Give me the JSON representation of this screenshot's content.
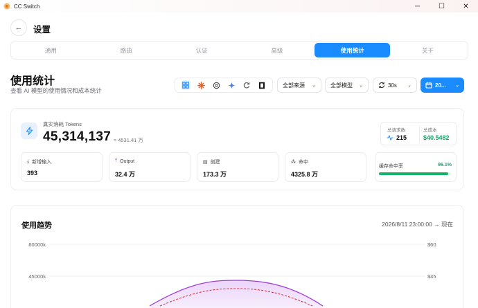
{
  "window": {
    "title": "CC Switch",
    "minimize": "─",
    "maximize": "☐",
    "close": "✕"
  },
  "header": {
    "back_icon": "←",
    "title": "设置"
  },
  "tabs": [
    {
      "label": "通用",
      "active": false
    },
    {
      "label": "路由",
      "active": false
    },
    {
      "label": "认证",
      "active": false
    },
    {
      "label": "高级",
      "active": false
    },
    {
      "label": "使用统计",
      "active": true
    },
    {
      "label": "关于",
      "active": false
    }
  ],
  "section": {
    "title": "使用统计",
    "subtitle": "查看 AI 模型的使用情况和成本统计"
  },
  "filters": {
    "app_icons": [
      "grid-icon",
      "claude-icon",
      "openai-icon",
      "gemini-icon",
      "refresh-app-icon",
      "box-app-icon"
    ],
    "source": "全部来源",
    "model": "全部模型",
    "interval": "30s",
    "date": "20..."
  },
  "stats": {
    "tokens_label": "真实消耗 Tokens",
    "tokens_value": "45,314,137",
    "tokens_approx": "≈ 4531.41 万",
    "total_requests_label": "总请求数",
    "total_requests_value": "215",
    "total_cost_label": "总成本",
    "total_cost_value": "$40.5482",
    "cards": [
      {
        "label": "新增输入",
        "value": "393",
        "icon": "⤓",
        "icon_color": "#555"
      },
      {
        "label": "Output",
        "value": "32.4 万",
        "icon": "⤒",
        "icon_color": "#9b3fd6"
      },
      {
        "label": "创建",
        "value": "173.3 万",
        "icon": "▤",
        "icon_color": "#555"
      },
      {
        "label": "命中",
        "value": "4325.8 万",
        "icon": "⁂",
        "icon_color": "#555"
      }
    ],
    "cache_label": "缓存命中率",
    "cache_pct": "96.1%",
    "cache_fraction": 0.961,
    "accent_green": "#15a36b"
  },
  "trend": {
    "title": "使用趋势",
    "range": "2026/8/11 23:00:00 → 现在"
  },
  "chart_data": {
    "type": "line",
    "y_left_ticks": [
      "60000k",
      "45000k"
    ],
    "y_right_ticks": [
      "$60",
      "$45"
    ]
  }
}
